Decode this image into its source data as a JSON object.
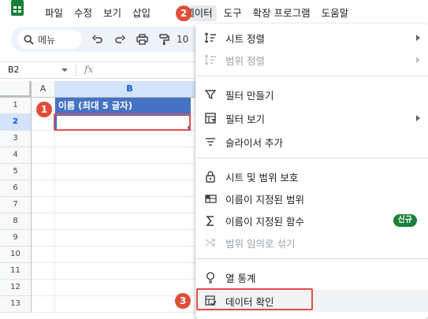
{
  "menubar": {
    "items": [
      "파일",
      "수정",
      "보기",
      "삽입",
      "데이터",
      "도구",
      "확장 프로그램",
      "도움말"
    ]
  },
  "toolbar": {
    "search_label": "메뉴",
    "zoom": "10"
  },
  "formula_bar": {
    "name_box": "B2",
    "fx": "fx"
  },
  "grid": {
    "columns": [
      "A",
      "B"
    ],
    "rows": [
      "1",
      "2",
      "3",
      "4",
      "5",
      "6",
      "7",
      "8",
      "9",
      "10",
      "11",
      "12",
      "13"
    ],
    "header_cell": "이름 (최대 5 글자)",
    "selected_row": "2"
  },
  "badges": [
    "1",
    "2",
    "3"
  ],
  "data_menu": {
    "items": [
      {
        "label": "시트 정렬",
        "icon": "sort-icon",
        "submenu": true,
        "disabled": false
      },
      {
        "label": "범위 정렬",
        "icon": "sort-range-icon",
        "submenu": true,
        "disabled": true
      },
      {
        "label": "필터 만들기",
        "icon": "filter-icon",
        "submenu": false,
        "disabled": false
      },
      {
        "label": "필터 보기",
        "icon": "filter-view-icon",
        "submenu": true,
        "disabled": false
      },
      {
        "label": "슬라이서 추가",
        "icon": "slicer-icon",
        "submenu": false,
        "disabled": false
      },
      {
        "label": "시트 및 범위 보호",
        "icon": "lock-icon",
        "submenu": false,
        "disabled": false
      },
      {
        "label": "이름이 지정된 범위",
        "icon": "named-range-icon",
        "submenu": false,
        "disabled": false
      },
      {
        "label": "이름이 지정된 함수",
        "icon": "sigma-icon",
        "submenu": false,
        "disabled": false,
        "badge": "신규"
      },
      {
        "label": "범위 임의로 섞기",
        "icon": "shuffle-icon",
        "submenu": false,
        "disabled": true
      },
      {
        "label": "열 통계",
        "icon": "bulb-icon",
        "submenu": false,
        "disabled": false
      },
      {
        "label": "데이터 확인",
        "icon": "data-validation-icon",
        "submenu": false,
        "disabled": false
      }
    ]
  },
  "colors": {
    "header_fill": "#4472c4",
    "annotation_red": "#e04e39",
    "new_badge": "#188038",
    "selection_blue": "#1a73e8"
  }
}
